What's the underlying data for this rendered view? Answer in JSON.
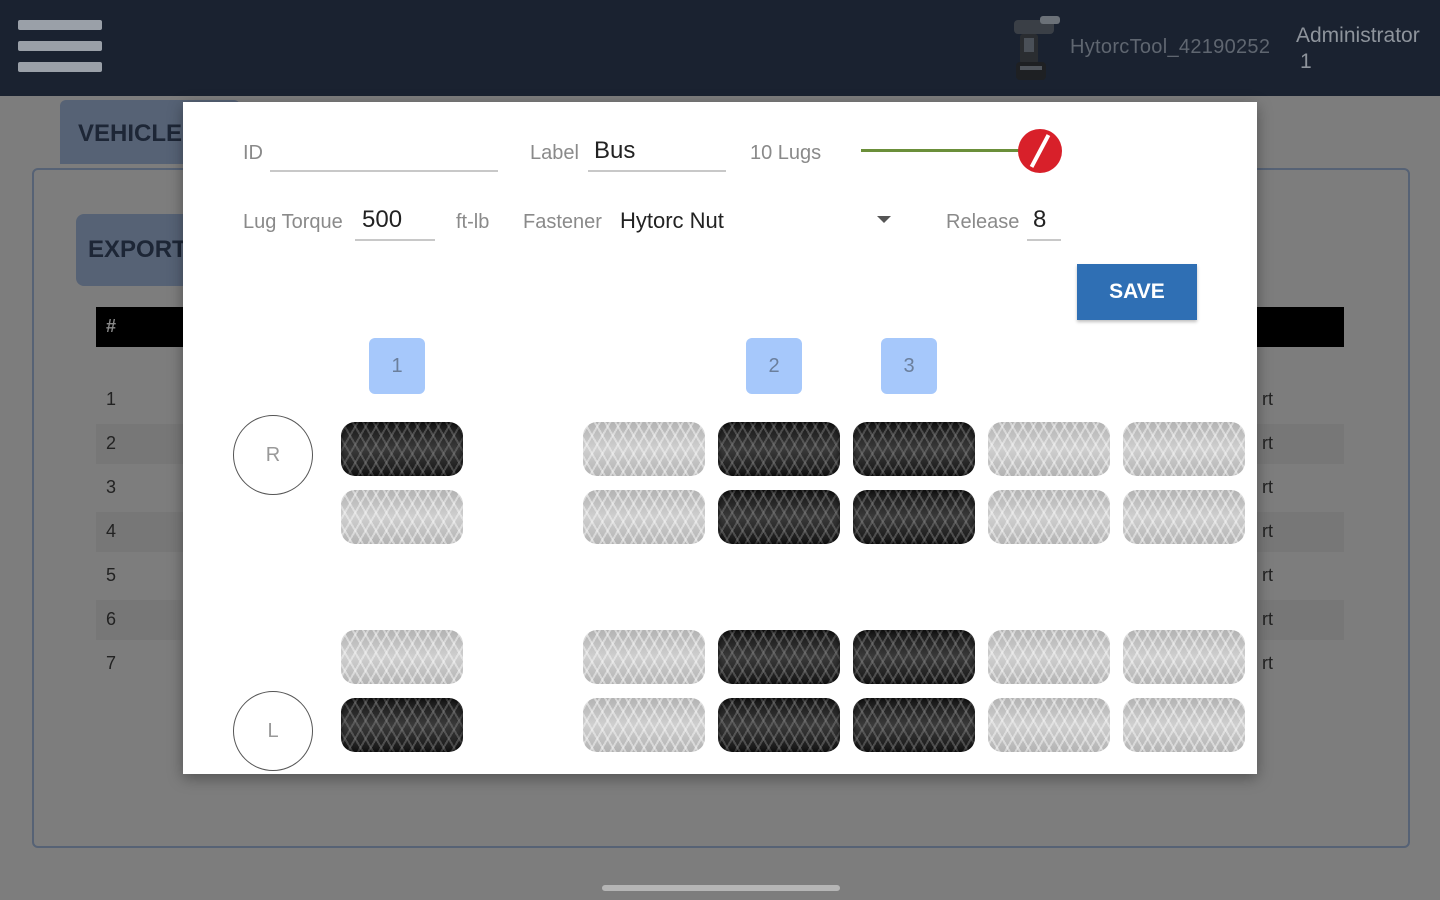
{
  "appbar": {
    "tool_name": "HytorcTool_42190252",
    "user_role": "Administrator",
    "user_number": "1"
  },
  "background": {
    "tab_label": "VEHICLE",
    "export_label": "EXPORT",
    "table_header": "#",
    "rows": [
      {
        "num": "1",
        "tail": "rt"
      },
      {
        "num": "2",
        "tail": "rt"
      },
      {
        "num": "3",
        "tail": "rt"
      },
      {
        "num": "4",
        "tail": "rt"
      },
      {
        "num": "5",
        "tail": "rt"
      },
      {
        "num": "6",
        "tail": "rt"
      },
      {
        "num": "7",
        "tail": "rt"
      }
    ]
  },
  "dialog": {
    "id_label": "ID",
    "id_value": "",
    "label_label": "Label",
    "label_value": "Bus",
    "lugs_label": "10 Lugs",
    "lugs_toggle_on": true,
    "torque_label": "Lug Torque",
    "torque_value": "500",
    "torque_unit": "ft-lb",
    "fastener_label": "Fastener",
    "fastener_value": "Hytorc Nut",
    "release_label": "Release",
    "release_value": "8",
    "save_label": "SAVE",
    "axle_badges": [
      "1",
      "2",
      "3"
    ],
    "side_right": "R",
    "side_left": "L",
    "tire_rows": [
      [
        true,
        false,
        true,
        true,
        false,
        false
      ],
      [
        false,
        false,
        true,
        true,
        false,
        false
      ],
      [
        false,
        false,
        true,
        true,
        false,
        false
      ],
      [
        true,
        false,
        true,
        true,
        false,
        false
      ]
    ]
  },
  "colors": {
    "appbar": "#1a2230",
    "save_button": "#2f6fb4",
    "axle_badge": "#a6c8fb",
    "toggle_thumb": "#d8202a",
    "toggle_track": "#6b8f3a"
  },
  "icons": {
    "menu": "hamburger-icon",
    "tool": "torque-wrench-icon",
    "dropdown": "chevron-down-icon"
  }
}
